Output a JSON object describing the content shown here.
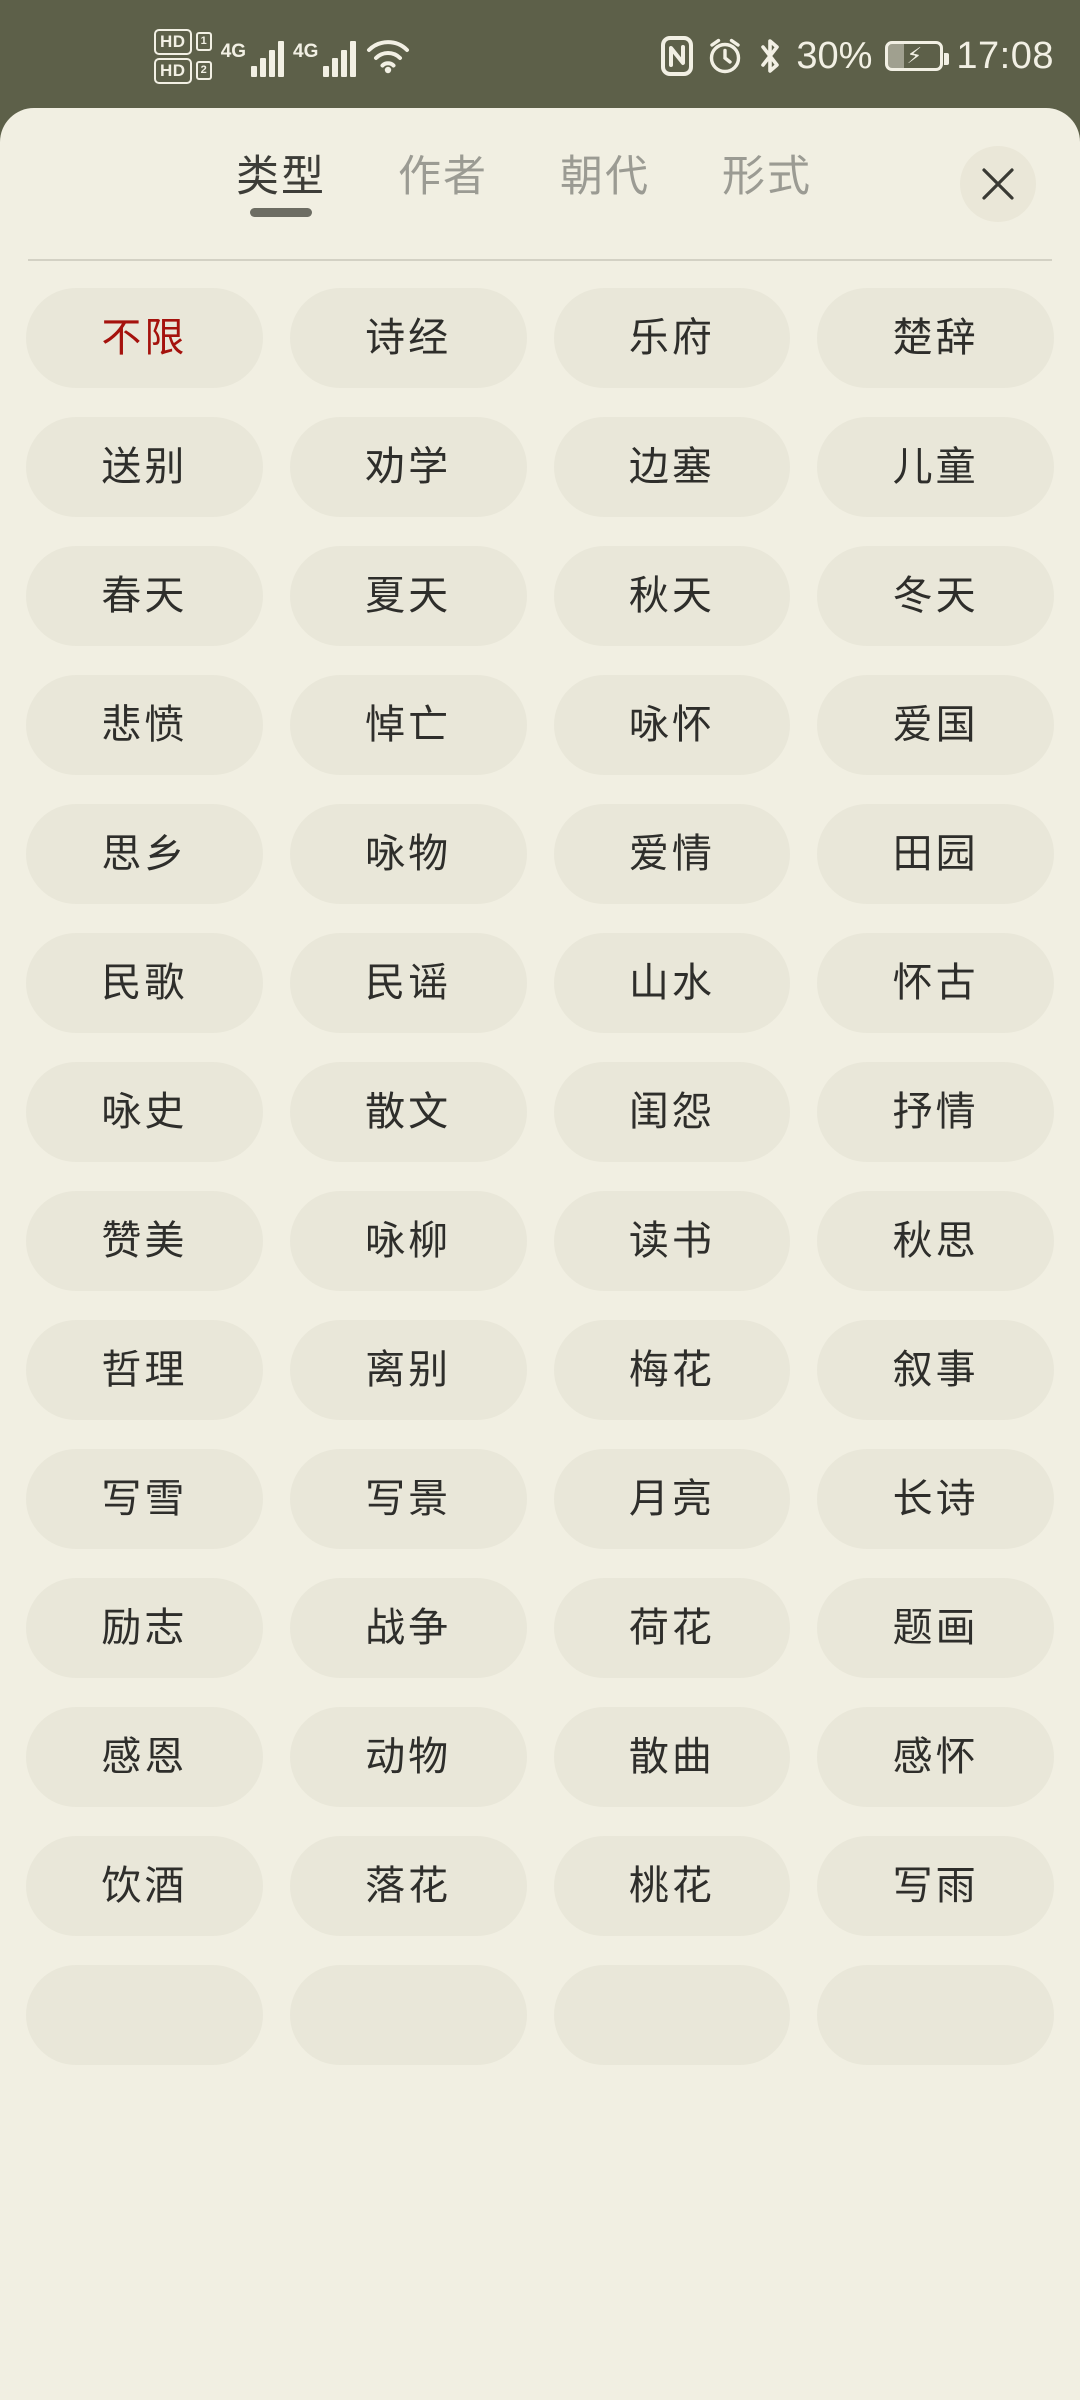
{
  "statusbar": {
    "hd_label_1": "HD",
    "hd_badge_1": "1",
    "hd_label_2": "HD",
    "hd_badge_2": "2",
    "network_1": "4G",
    "network_2": "4G",
    "icons": [
      "hd-volte-icon",
      "signal-bars-icon",
      "wifi-icon",
      "nfc-icon",
      "alarm-icon",
      "bluetooth-icon",
      "battery-charging-icon"
    ],
    "battery_percent": "30%",
    "time": "17:08"
  },
  "header": {
    "tabs": [
      {
        "label": "类型",
        "active": true
      },
      {
        "label": "作者",
        "active": false
      },
      {
        "label": "朝代",
        "active": false
      },
      {
        "label": "形式",
        "active": false
      }
    ],
    "close_label": "×"
  },
  "colors": {
    "statusbar_bg": "#5d6049",
    "sheet_bg": "#f1efe2",
    "chip_bg": "#e9e7d9",
    "chip_text": "#2e2e2b",
    "selected_text": "#a5120d",
    "tab_active": "#3d3d38",
    "tab_inactive": "#9b9b93"
  },
  "categories": [
    {
      "label": "不限",
      "selected": true
    },
    {
      "label": "诗经",
      "selected": false
    },
    {
      "label": "乐府",
      "selected": false
    },
    {
      "label": "楚辞",
      "selected": false
    },
    {
      "label": "送别",
      "selected": false
    },
    {
      "label": "劝学",
      "selected": false
    },
    {
      "label": "边塞",
      "selected": false
    },
    {
      "label": "儿童",
      "selected": false
    },
    {
      "label": "春天",
      "selected": false
    },
    {
      "label": "夏天",
      "selected": false
    },
    {
      "label": "秋天",
      "selected": false
    },
    {
      "label": "冬天",
      "selected": false
    },
    {
      "label": "悲愤",
      "selected": false
    },
    {
      "label": "悼亡",
      "selected": false
    },
    {
      "label": "咏怀",
      "selected": false
    },
    {
      "label": "爱国",
      "selected": false
    },
    {
      "label": "思乡",
      "selected": false
    },
    {
      "label": "咏物",
      "selected": false
    },
    {
      "label": "爱情",
      "selected": false
    },
    {
      "label": "田园",
      "selected": false
    },
    {
      "label": "民歌",
      "selected": false
    },
    {
      "label": "民谣",
      "selected": false
    },
    {
      "label": "山水",
      "selected": false
    },
    {
      "label": "怀古",
      "selected": false
    },
    {
      "label": "咏史",
      "selected": false
    },
    {
      "label": "散文",
      "selected": false
    },
    {
      "label": "闺怨",
      "selected": false
    },
    {
      "label": "抒情",
      "selected": false
    },
    {
      "label": "赞美",
      "selected": false
    },
    {
      "label": "咏柳",
      "selected": false
    },
    {
      "label": "读书",
      "selected": false
    },
    {
      "label": "秋思",
      "selected": false
    },
    {
      "label": "哲理",
      "selected": false
    },
    {
      "label": "离别",
      "selected": false
    },
    {
      "label": "梅花",
      "selected": false
    },
    {
      "label": "叙事",
      "selected": false
    },
    {
      "label": "写雪",
      "selected": false
    },
    {
      "label": "写景",
      "selected": false
    },
    {
      "label": "月亮",
      "selected": false
    },
    {
      "label": "长诗",
      "selected": false
    },
    {
      "label": "励志",
      "selected": false
    },
    {
      "label": "战争",
      "selected": false
    },
    {
      "label": "荷花",
      "selected": false
    },
    {
      "label": "题画",
      "selected": false
    },
    {
      "label": "感恩",
      "selected": false
    },
    {
      "label": "动物",
      "selected": false
    },
    {
      "label": "散曲",
      "selected": false
    },
    {
      "label": "感怀",
      "selected": false
    },
    {
      "label": "饮酒",
      "selected": false
    },
    {
      "label": "落花",
      "selected": false
    },
    {
      "label": "桃花",
      "selected": false
    },
    {
      "label": "写雨",
      "selected": false
    },
    {
      "label": "",
      "selected": false
    },
    {
      "label": "",
      "selected": false
    },
    {
      "label": "",
      "selected": false
    },
    {
      "label": "",
      "selected": false
    }
  ]
}
